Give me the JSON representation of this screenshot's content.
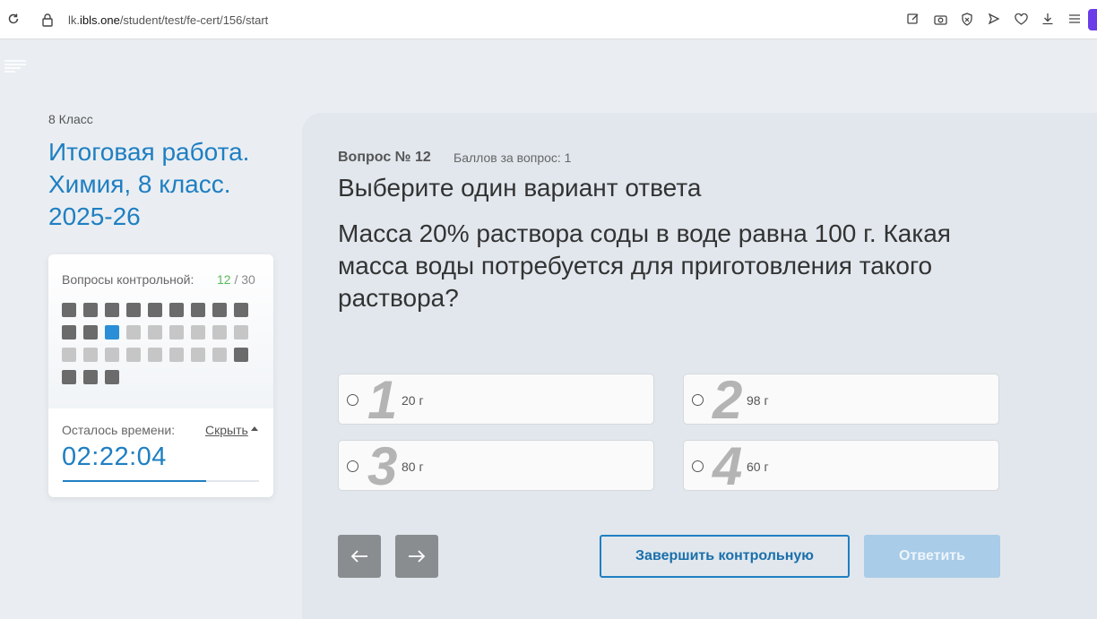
{
  "browser": {
    "url_prefix": "lk.",
    "url_domain": "ibls.one",
    "url_path": "/student/test/fe-cert/156/start"
  },
  "sidebar": {
    "grade": "8 Класс",
    "title": "Итоговая работа. Химия, 8 класс. 2025-26",
    "questions_label": "Вопросы контрольной:",
    "current_question": "12",
    "count_separator": " / ",
    "total_questions": "30",
    "question_states": [
      "answered",
      "answered",
      "answered",
      "answered",
      "answered",
      "answered",
      "answered",
      "answered",
      "answered",
      "answered",
      "answered",
      "current",
      "pending",
      "pending",
      "pending",
      "pending",
      "pending",
      "pending",
      "pending",
      "pending",
      "pending",
      "pending",
      "pending",
      "pending",
      "pending",
      "pending",
      "answered",
      "answered",
      "answered",
      "answered"
    ],
    "time_label": "Осталось времени:",
    "hide_label": "Скрыть",
    "timer": "02:22:04",
    "time_remaining_fraction": 0.73
  },
  "question": {
    "number_label": "Вопрос № 12",
    "points_label": "Баллов за вопрос: 1",
    "instruction": "Выберите один вариант ответа",
    "text": "Масса 20% раствора соды в воде равна 100 г. Какая масса воды потребуется для приготовления такого раствора?",
    "options": [
      {
        "num": "1",
        "text": "20 г"
      },
      {
        "num": "2",
        "text": "98 г"
      },
      {
        "num": "3",
        "text": "80 г"
      },
      {
        "num": "4",
        "text": "60 г"
      }
    ]
  },
  "actions": {
    "finish_label": "Завершить контрольную",
    "answer_label": "Ответить"
  },
  "colors": {
    "accent": "#1f7fc2",
    "answered": "#6b6b6b",
    "current": "#2a8fd6",
    "pending": "#c6c6c6",
    "answer_disabled": "#a9cce8"
  }
}
